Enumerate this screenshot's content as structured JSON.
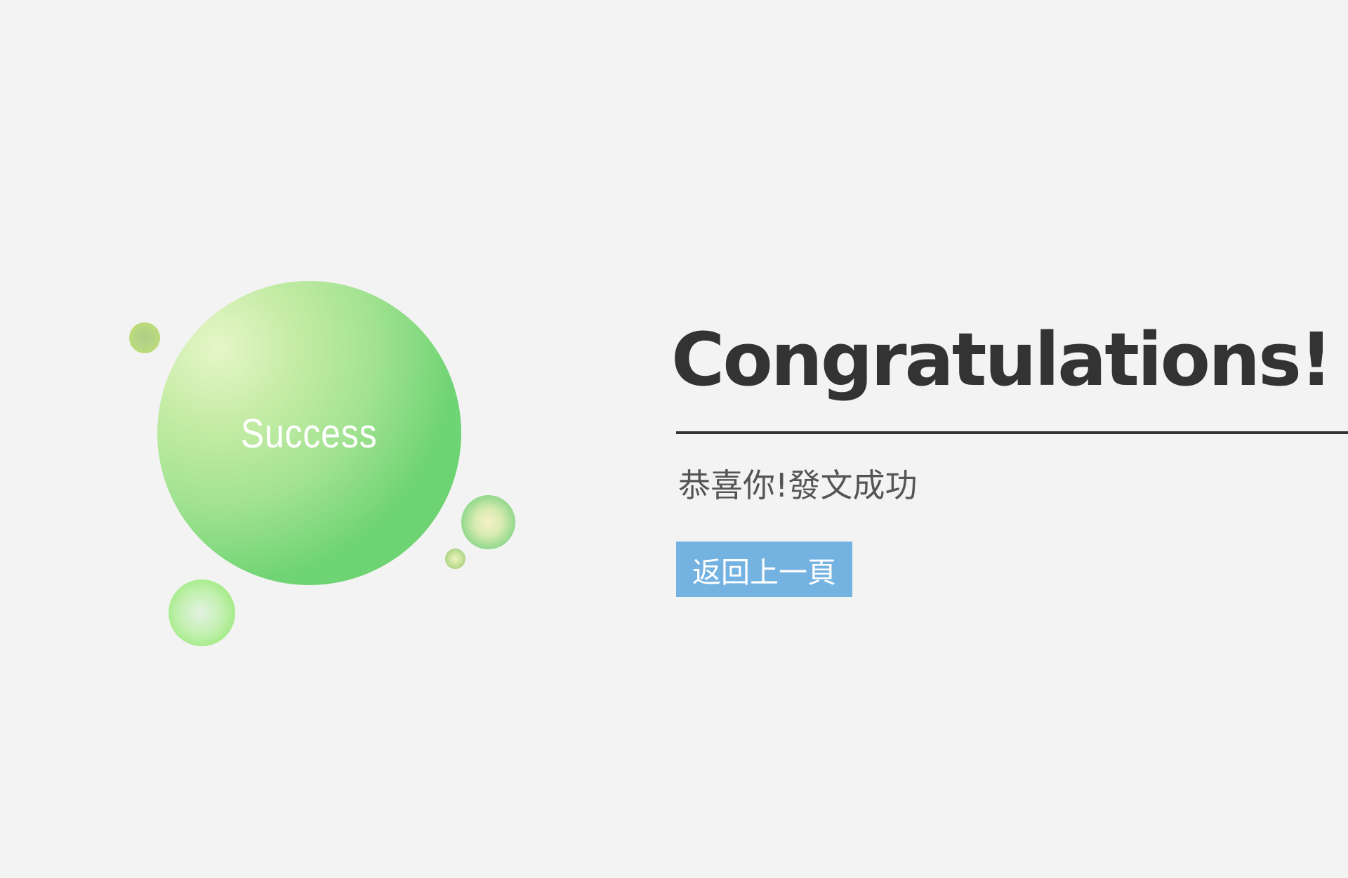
{
  "bubble": {
    "label": "Success"
  },
  "message": {
    "heading": "Congratulations!",
    "subtitle": "恭喜你!發文成功"
  },
  "actions": {
    "back_label": "返回上一頁"
  },
  "colors": {
    "background": "#f3f3f3",
    "heading_text": "#333333",
    "divider": "#333333",
    "subtitle_text": "#555555",
    "button_background": "#74b2e2",
    "button_text": "#ffffff",
    "success_bubble": "#6dd273"
  }
}
